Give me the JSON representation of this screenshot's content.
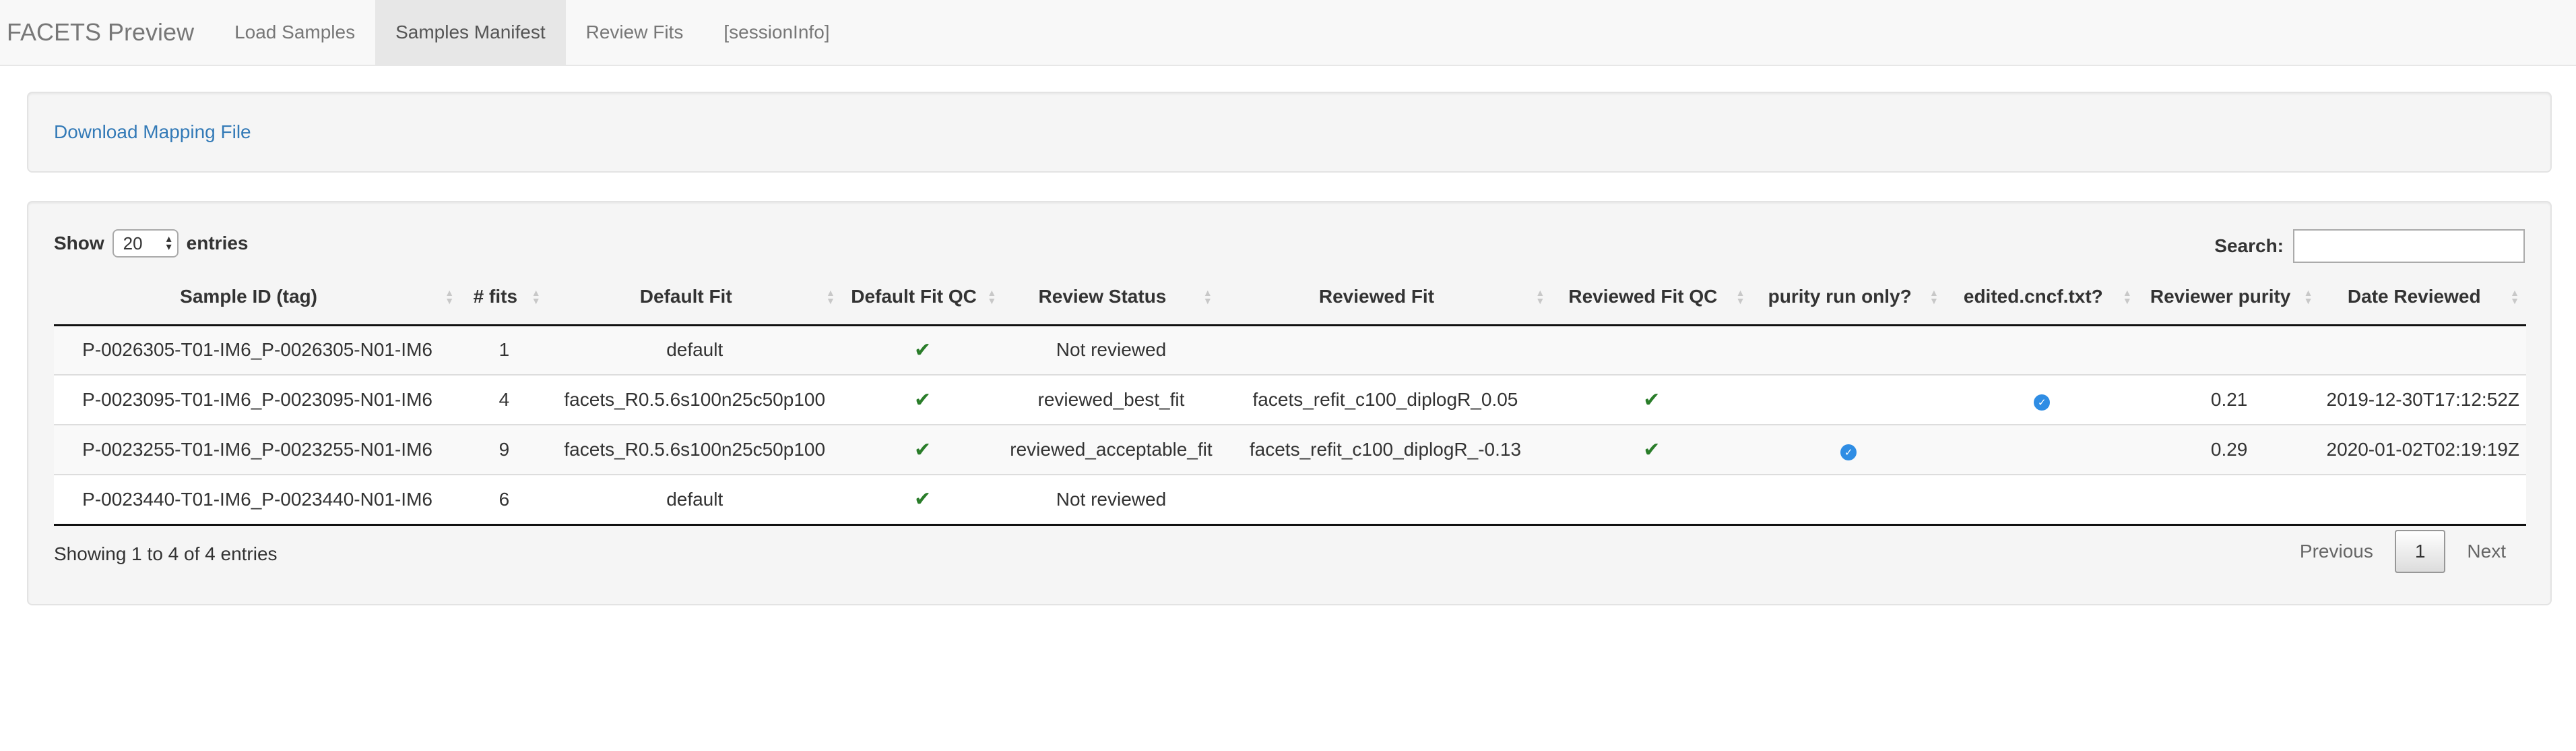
{
  "navbar": {
    "brand": "FACETS Preview",
    "tabs": [
      {
        "label": "Load Samples",
        "active": false
      },
      {
        "label": "Samples Manifest",
        "active": true
      },
      {
        "label": "Review Fits",
        "active": false
      },
      {
        "label": "[sessionInfo]",
        "active": false
      }
    ]
  },
  "download": {
    "label": "Download Mapping File"
  },
  "table_controls": {
    "show_label": "Show",
    "length_value": "20",
    "entries_label": "entries",
    "search_label": "Search:",
    "search_value": ""
  },
  "table": {
    "columns": [
      "Sample ID (tag)",
      "# fits",
      "Default Fit",
      "Default Fit QC",
      "Review Status",
      "Reviewed Fit",
      "Reviewed Fit QC",
      "purity run only?",
      "edited.cncf.txt?",
      "Reviewer purity",
      "Date Reviewed"
    ],
    "rows": [
      {
        "sample_id": "P-0026305-T01-IM6_P-0026305-N01-IM6",
        "num_fits": "1",
        "default_fit": "default",
        "default_fit_qc": true,
        "review_status": "Not reviewed",
        "reviewed_fit": "",
        "reviewed_fit_qc": false,
        "purity_run_only": false,
        "edited_cncf": false,
        "reviewer_purity": "",
        "date_reviewed": ""
      },
      {
        "sample_id": "P-0023095-T01-IM6_P-0023095-N01-IM6",
        "num_fits": "4",
        "default_fit": "facets_R0.5.6s100n25c50p100",
        "default_fit_qc": true,
        "review_status": "reviewed_best_fit",
        "reviewed_fit": "facets_refit_c100_diplogR_0.05",
        "reviewed_fit_qc": true,
        "purity_run_only": false,
        "edited_cncf": true,
        "reviewer_purity": "0.21",
        "date_reviewed": "2019-12-30T17:12:52Z"
      },
      {
        "sample_id": "P-0023255-T01-IM6_P-0023255-N01-IM6",
        "num_fits": "9",
        "default_fit": "facets_R0.5.6s100n25c50p100",
        "default_fit_qc": true,
        "review_status": "reviewed_acceptable_fit",
        "reviewed_fit": "facets_refit_c100_diplogR_-0.13",
        "reviewed_fit_qc": true,
        "purity_run_only": true,
        "edited_cncf": false,
        "reviewer_purity": "0.29",
        "date_reviewed": "2020-01-02T02:19:19Z"
      },
      {
        "sample_id": "P-0023440-T01-IM6_P-0023440-N01-IM6",
        "num_fits": "6",
        "default_fit": "default",
        "default_fit_qc": true,
        "review_status": "Not reviewed",
        "reviewed_fit": "",
        "reviewed_fit_qc": false,
        "purity_run_only": false,
        "edited_cncf": false,
        "reviewer_purity": "",
        "date_reviewed": ""
      }
    ]
  },
  "footer": {
    "info": "Showing 1 to 4 of 4 entries",
    "previous_label": "Previous",
    "current_page": "1",
    "next_label": "Next"
  },
  "icons": {
    "qc_check": "check-icon",
    "flag_check": "blue-circle-check-icon",
    "sort": "sort-arrows-icon"
  },
  "colors": {
    "link": "#337ab7",
    "check_green": "#2a7d2a",
    "check_blue": "#2f8de4"
  }
}
